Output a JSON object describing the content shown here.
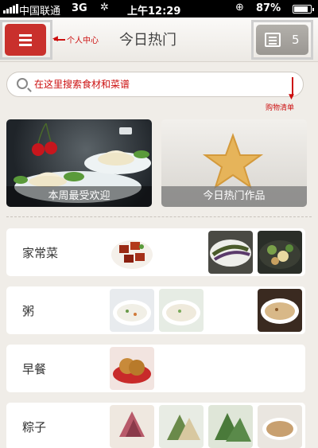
{
  "status_bar": {
    "carrier": "中国联通",
    "network": "3G",
    "time": "上午12:29",
    "battery": "87%",
    "battery_level": 0.87,
    "icons": [
      "signal-bars-icon",
      "wifi-icon",
      "rotation-lock-icon",
      "battery-icon"
    ]
  },
  "header": {
    "title": "今日热门",
    "menu_icon": "hamburger-menu-icon",
    "menu_annotation": "个人中心",
    "list_icon": "shopping-list-icon",
    "list_count": "5",
    "list_annotation": "购物清单",
    "brand_color": "#c9302c",
    "annotation_color": "#cc1010"
  },
  "search": {
    "icon": "search-icon",
    "placeholder": "在这里搜索食材和菜谱"
  },
  "featured": [
    {
      "label": "本周最受欢迎"
    },
    {
      "label": "今日热门作品"
    }
  ],
  "categories": [
    {
      "name": "家常菜"
    },
    {
      "name": "粥"
    },
    {
      "name": "早餐"
    },
    {
      "name": "粽子"
    }
  ]
}
